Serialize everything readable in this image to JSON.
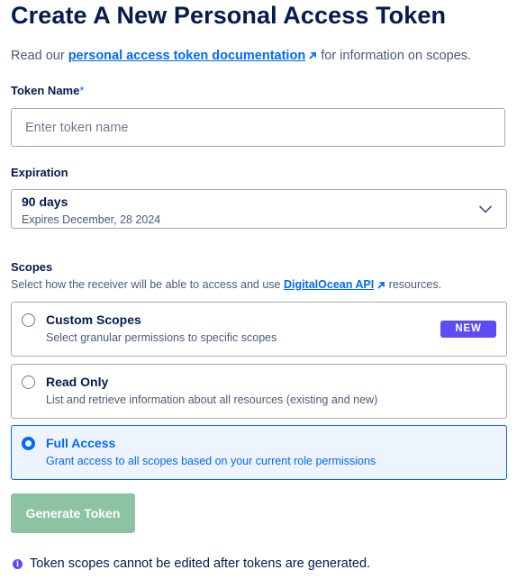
{
  "title": "Create A New Personal Access Token",
  "intro": {
    "prefix": "Read our ",
    "link_text": "personal access token documentation",
    "suffix": " for information on scopes.",
    "link_icon": "external-arrow-icon"
  },
  "token_name": {
    "label": "Token Name",
    "required_marker": "*",
    "placeholder": "Enter token name",
    "value": ""
  },
  "expiration": {
    "label": "Expiration",
    "selected": "90 days",
    "expires_text": "Expires December, 28 2024",
    "icon": "chevron-down-icon"
  },
  "scopes": {
    "label": "Scopes",
    "desc_prefix": "Select how the receiver will be able to access and use ",
    "desc_link": "DigitalOcean API",
    "desc_suffix": " resources.",
    "options": [
      {
        "title": "Custom Scopes",
        "desc": "Select granular permissions to specific scopes",
        "badge": "NEW",
        "selected": false
      },
      {
        "title": "Read Only",
        "desc": "List and retrieve information about all resources (existing and new)",
        "selected": false
      },
      {
        "title": "Full Access",
        "desc": "Grant access to all scopes based on your current role permissions",
        "selected": true
      }
    ]
  },
  "generate_button": "Generate Token",
  "note": "Token scopes cannot be edited after tokens are generated.",
  "colors": {
    "brand_blue": "#0069ff",
    "navy": "#031b4e",
    "badge_purple": "#5b4cf5",
    "disabled_green": "#8cc3a3",
    "selected_bg": "#eef4fe"
  }
}
